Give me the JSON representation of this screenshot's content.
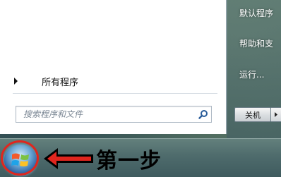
{
  "start_menu": {
    "all_programs_label": "所有程序",
    "search": {
      "placeholder": "搜索程序和文件"
    },
    "right_items": [
      {
        "label": "默认程序"
      },
      {
        "label": "帮助和支"
      },
      {
        "label": "运行..."
      }
    ],
    "shutdown_label": "关机"
  },
  "annotation": {
    "step_label": "第一步",
    "ring_color": "#e0261e",
    "arrow_color": "#e0261e"
  },
  "icons": {
    "start_orb": "windows-logo-icon",
    "search": "magnifier-icon",
    "expand": "triangle-right-icon"
  }
}
